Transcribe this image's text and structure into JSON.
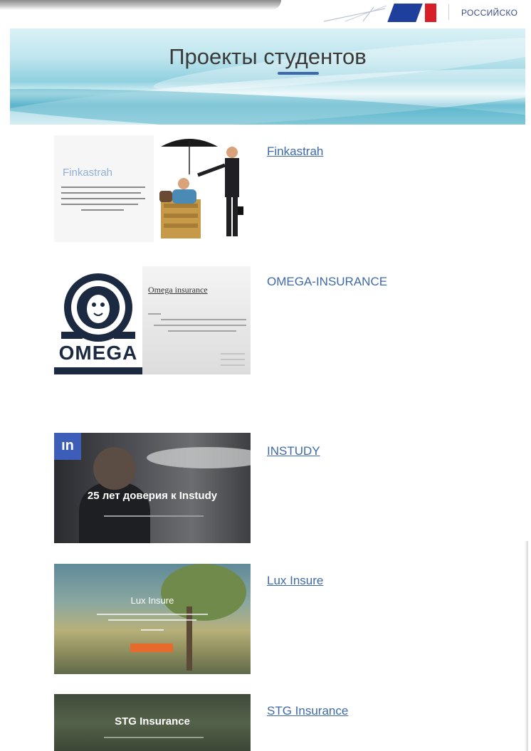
{
  "header": {
    "org_text": "РОССИЙСКО"
  },
  "banner": {
    "title": "Проекты студентов"
  },
  "projects": [
    {
      "name": "Finkastrah",
      "thumb_title": "Finkastrah"
    },
    {
      "name": "OMEGA-INSURANCE",
      "thumb_logo": "OMEGA",
      "thumb_title": "Omega insurance"
    },
    {
      "name": "INSTUDY",
      "thumb_logo": "ın",
      "thumb_headline": "25 лет доверия к Instudy"
    },
    {
      "name": "Lux Insure",
      "thumb_title": "Lux Insure"
    },
    {
      "name": "STG Insurance",
      "thumb_title": "STG Insurance"
    }
  ],
  "colors": {
    "link": "#3f6aa8",
    "banner_accent": "#3f6aa8",
    "flag_blue": "#1f3f9c",
    "flag_red": "#d81e27"
  }
}
